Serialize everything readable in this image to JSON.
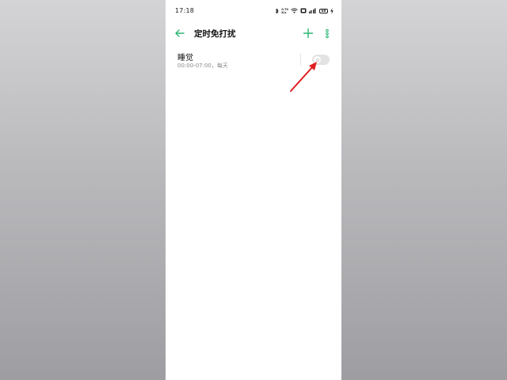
{
  "status_bar": {
    "time": "17:18",
    "net_speed_value": "0.70",
    "net_speed_unit": "K/s",
    "icons": [
      "bluetooth-icon",
      "wifi-icon",
      "hd-icon",
      "signal-icon",
      "battery-icon",
      "charging-icon"
    ],
    "battery_level": "68"
  },
  "header": {
    "title": "定时免打扰",
    "back_icon": "back-arrow-icon",
    "add_icon": "plus-icon",
    "more_icon": "more-vertical-icon"
  },
  "schedules": [
    {
      "title": "睡觉",
      "subtitle": "00:00-07:00，每天",
      "enabled": false
    }
  ],
  "colors": {
    "accent": "#2bb673",
    "annotation_arrow": "#e02020",
    "toggle_off": "#e3e3e3",
    "background_gray": "#b9b9bc"
  }
}
